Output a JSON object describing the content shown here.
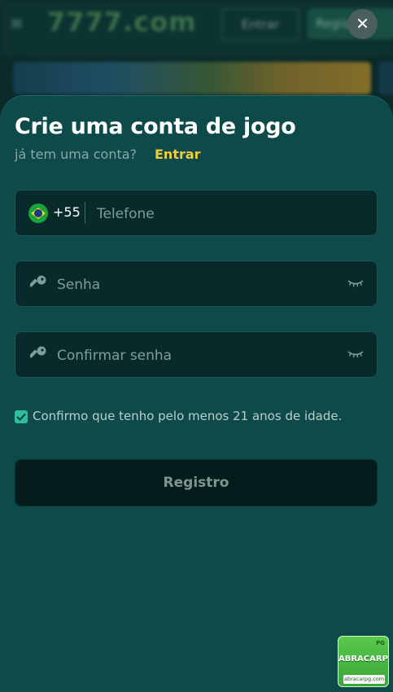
{
  "background": {
    "menu_icon": "hamburger-icon",
    "logo": "7777.com",
    "entrar_button": "Entrar",
    "register_button": "Registr"
  },
  "close_icon": "close-icon",
  "modal": {
    "title": "Crie uma conta de jogo",
    "have_account": "já tem uma conta?",
    "login_link": "Entrar",
    "phone": {
      "country_flag": "brazil-flag-icon",
      "dial_code": "+55",
      "placeholder": "Telefone",
      "value": ""
    },
    "password": {
      "icon": "key-icon",
      "placeholder": "Senha",
      "value": "",
      "toggle_icon": "eye-closed-icon"
    },
    "confirm_password": {
      "icon": "key-icon",
      "placeholder": "Confirmar senha",
      "value": "",
      "toggle_icon": "eye-closed-icon"
    },
    "age_checkbox": {
      "checked": true,
      "label": "Confirmo que tenho pelo menos 21 anos de idade."
    },
    "register_button": "Registro"
  },
  "badge": {
    "top_text": "PG",
    "name": "ABRACARPG",
    "url": "abracarpg.com"
  },
  "colors": {
    "panel_bg": "#0e4a4a",
    "field_bg": "#082a2a",
    "accent_link": "#f2cc3c",
    "checkbox": "#2dbf9a",
    "button_bg": "#041c1c"
  }
}
